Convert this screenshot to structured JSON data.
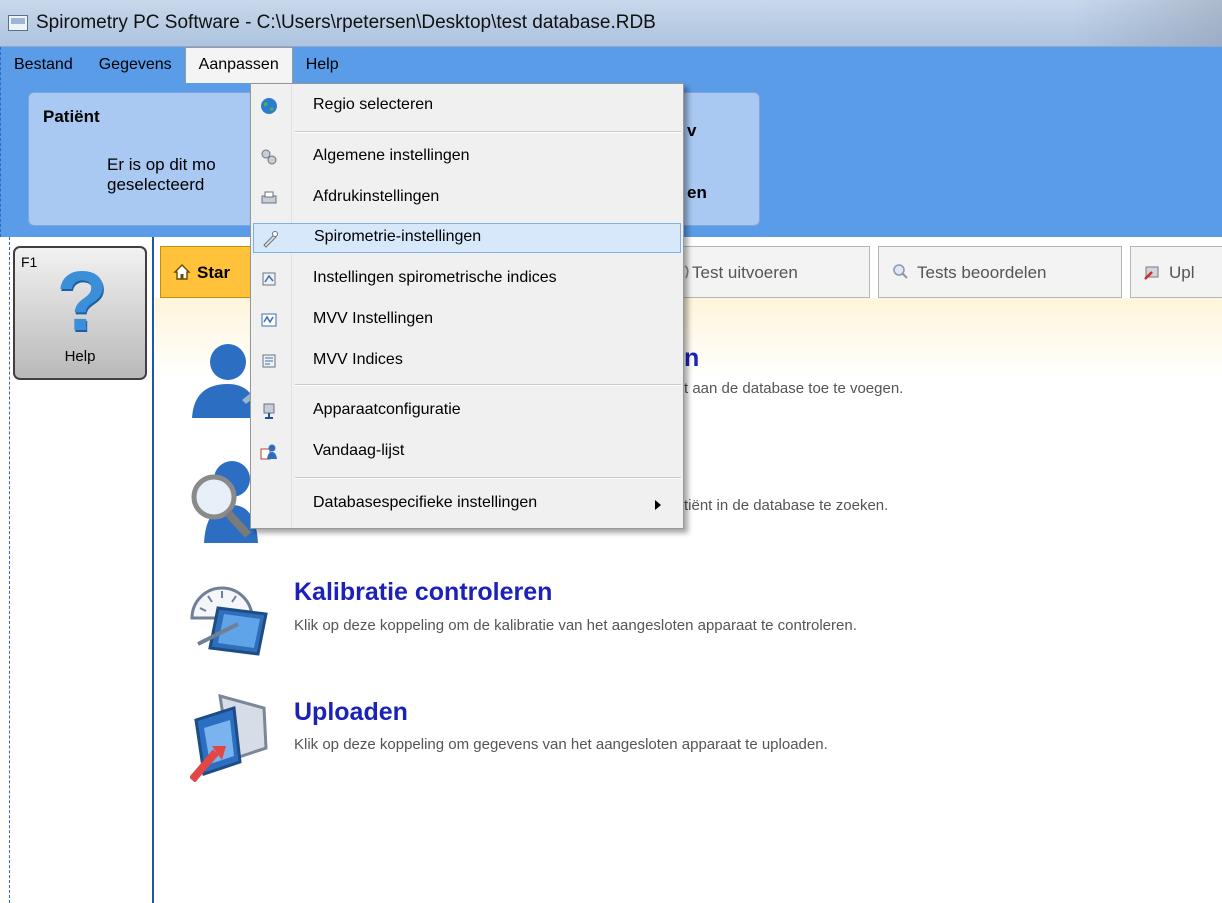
{
  "window": {
    "title": "Spirometry PC Software - C:\\Users\\rpetersen\\Desktop\\test database.RDB"
  },
  "menubar": {
    "items": [
      "Bestand",
      "Gegevens",
      "Aanpassen",
      "Help"
    ],
    "open_index": 2
  },
  "patient_panel": {
    "title": "Patiënt",
    "message_line1": "Er is op dit mo",
    "message_line2": "geselecteerd",
    "right_text_1": "v",
    "right_text_2": "en"
  },
  "help_button": {
    "shortcut": "F1",
    "label": "Help"
  },
  "tabs": [
    {
      "label": "Star",
      "icon": "home-icon",
      "active": true
    },
    {
      "label": "Test uitvoeren",
      "icon": "test-icon",
      "active": false
    },
    {
      "label": "Tests beoordelen",
      "icon": "magnifier-icon",
      "active": false
    },
    {
      "label": "Upl",
      "icon": "upload-icon",
      "active": false
    }
  ],
  "actions": [
    {
      "title": "n",
      "description": "t aan de database toe te voegen.",
      "icon": "add-patient-icon"
    },
    {
      "title": "",
      "description": "tiënt in de database te zoeken.",
      "icon": "search-patient-icon"
    },
    {
      "title": "Kalibratie controleren",
      "description": "Klik op deze koppeling om de kalibratie van het aangesloten apparaat te controleren.",
      "icon": "calibration-icon"
    },
    {
      "title": "Uploaden",
      "description": "Klik op deze koppeling om gegevens van het aangesloten apparaat te uploaden.",
      "icon": "upload-device-icon"
    }
  ],
  "dropdown": {
    "items": [
      {
        "label": "Regio selecteren",
        "icon": "globe-icon"
      },
      {
        "label": "Algemene instellingen",
        "icon": "gears-icon"
      },
      {
        "label": "Afdrukinstellingen",
        "icon": "printer-icon"
      },
      {
        "label": "Spirometrie-instellingen",
        "icon": "spirometer-icon",
        "highlighted": true
      },
      {
        "label": "Instellingen spirometrische indices",
        "icon": "indices-settings-icon"
      },
      {
        "label": "MVV Instellingen",
        "icon": "mvv-settings-icon"
      },
      {
        "label": "MVV Indices",
        "icon": "mvv-indices-icon"
      },
      {
        "label": "Apparaatconfiguratie",
        "icon": "device-config-icon"
      },
      {
        "label": "Vandaag-lijst",
        "icon": "today-list-icon"
      },
      {
        "label": "Databasespecifieke instellingen",
        "icon": "none",
        "has_submenu": true
      }
    ]
  },
  "colors": {
    "menubar_bg": "#5b9ce8",
    "patient_panel_bg": "#a9c9f2",
    "active_tab": "#ffc23a",
    "action_title": "#1c21b8",
    "menu_highlight": "#d7e8fb"
  }
}
